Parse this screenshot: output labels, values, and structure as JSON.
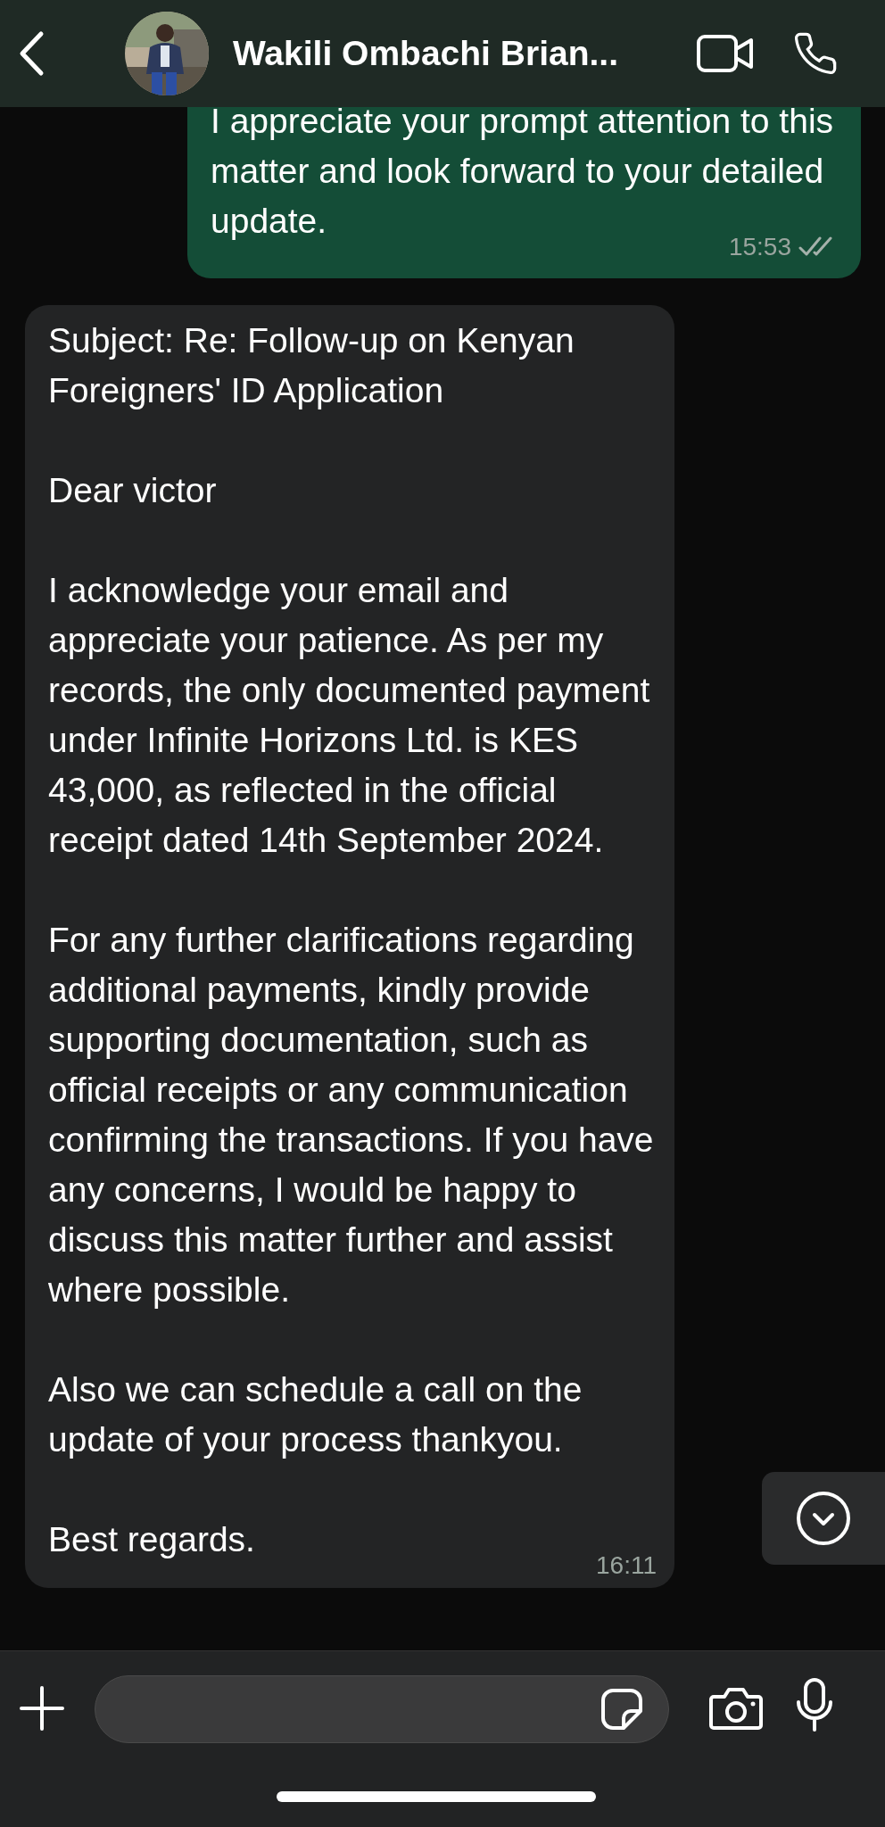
{
  "header": {
    "contact_name": "Wakili Ombachi Brian..."
  },
  "messages": [
    {
      "kind": "outgoing",
      "paragraphs": [
        "I appreciate your prompt attention to this matter and look forward to your detailed update."
      ],
      "time": "15:53",
      "read": false
    },
    {
      "kind": "incoming",
      "paragraphs": [
        "Subject: Re: Follow-up on Kenyan Foreigners' ID Application",
        "Dear victor",
        "I acknowledge your email and appreciate your patience. As per my records, the only documented payment under Infinite Horizons Ltd. is KES 43,000, as reflected in the official receipt dated 14th September 2024.",
        "For any further clarifications regarding additional payments, kindly provide supporting documentation, such as official receipts or any communication confirming the transactions. If you have any concerns, I would be happy to discuss this matter further and assist where possible.",
        "Also we can schedule a call on the update of your process thankyou.",
        "Best regards."
      ],
      "time": "16:11"
    }
  ]
}
